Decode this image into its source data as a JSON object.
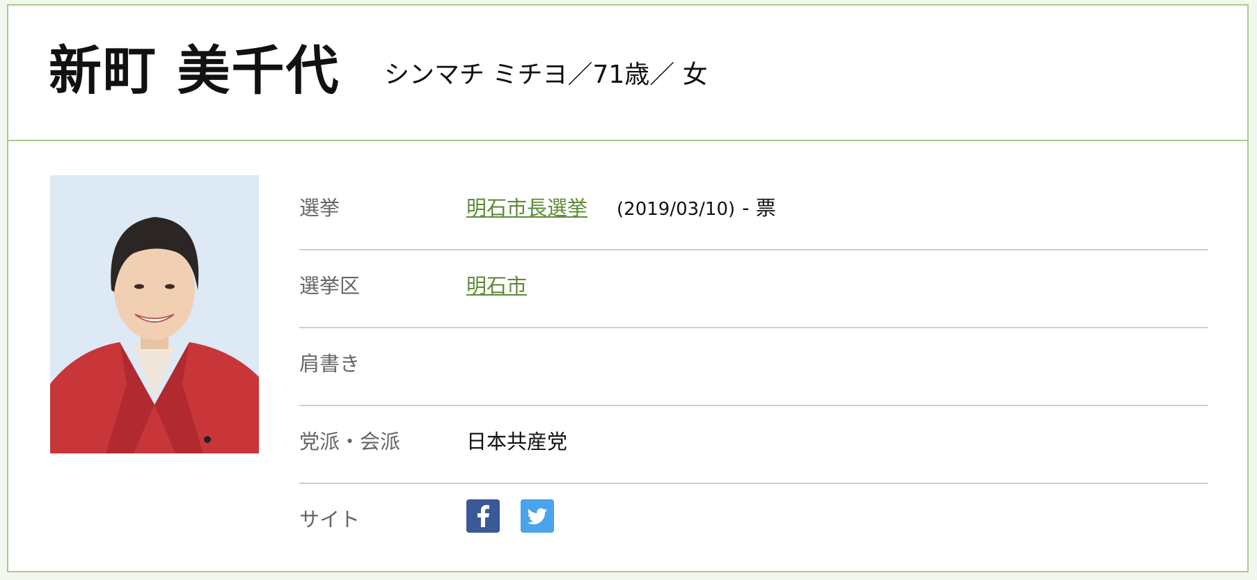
{
  "header": {
    "name": "新町 美千代",
    "subinfo": "シンマチ ミチヨ／71歳／ 女"
  },
  "photo": {
    "alt": "新町 美千代"
  },
  "rows": {
    "election": {
      "label": "選挙",
      "link": "明石市長選挙",
      "date": "(2019/03/10)",
      "votes": "- 票"
    },
    "district": {
      "label": "選挙区",
      "link": "明石市"
    },
    "title": {
      "label": "肩書き",
      "value": ""
    },
    "party": {
      "label": "党派・会派",
      "value": "日本共産党"
    },
    "site": {
      "label": "サイト",
      "icons": [
        "facebook-icon",
        "twitter-icon"
      ]
    }
  },
  "colors": {
    "accent_border": "#a9c98a",
    "link": "#5e8a37",
    "facebook": "#3b5998",
    "twitter": "#4ba3ec"
  }
}
